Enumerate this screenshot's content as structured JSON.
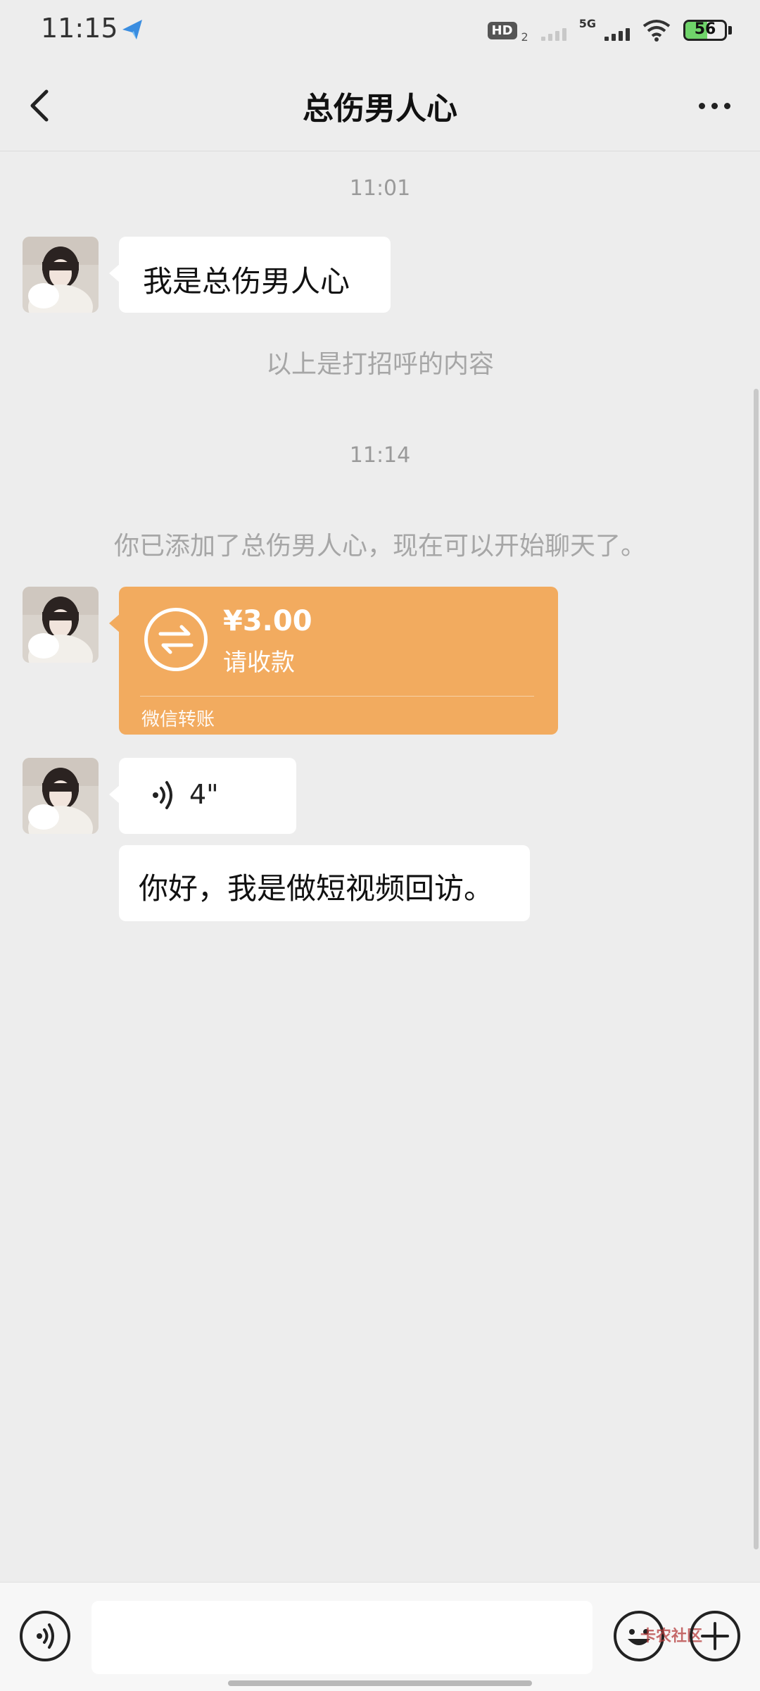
{
  "status_bar": {
    "time": "11:15",
    "hd_label": "HD",
    "hd_sub": "2",
    "network": "5G",
    "battery": "56",
    "battery_level": 0.56,
    "battery_color": "#6fd46a"
  },
  "header": {
    "title": "总伤男人心",
    "back_icon": "chevron-left-icon",
    "more_icon": "more-dots-icon"
  },
  "chat": {
    "timestamp_1": "11:01",
    "message_1": "我是总伤男人心",
    "greeting_notice": "以上是打招呼的内容",
    "timestamp_2": "11:14",
    "added_notice": "你已添加了总伤男人心，现在可以开始聊天了。",
    "transfer": {
      "amount": "¥3.00",
      "status": "请收款",
      "footer": "微信转账",
      "color": "#f2ab5f"
    },
    "voice": {
      "duration": "4\""
    },
    "message_2": "你好，我是做短视频回访。"
  },
  "input_bar": {
    "text_value": "",
    "voice_icon": "voice-icon",
    "emoji_icon": "emoji-icon",
    "plus_icon": "plus-icon"
  },
  "watermark": "卡农社区"
}
